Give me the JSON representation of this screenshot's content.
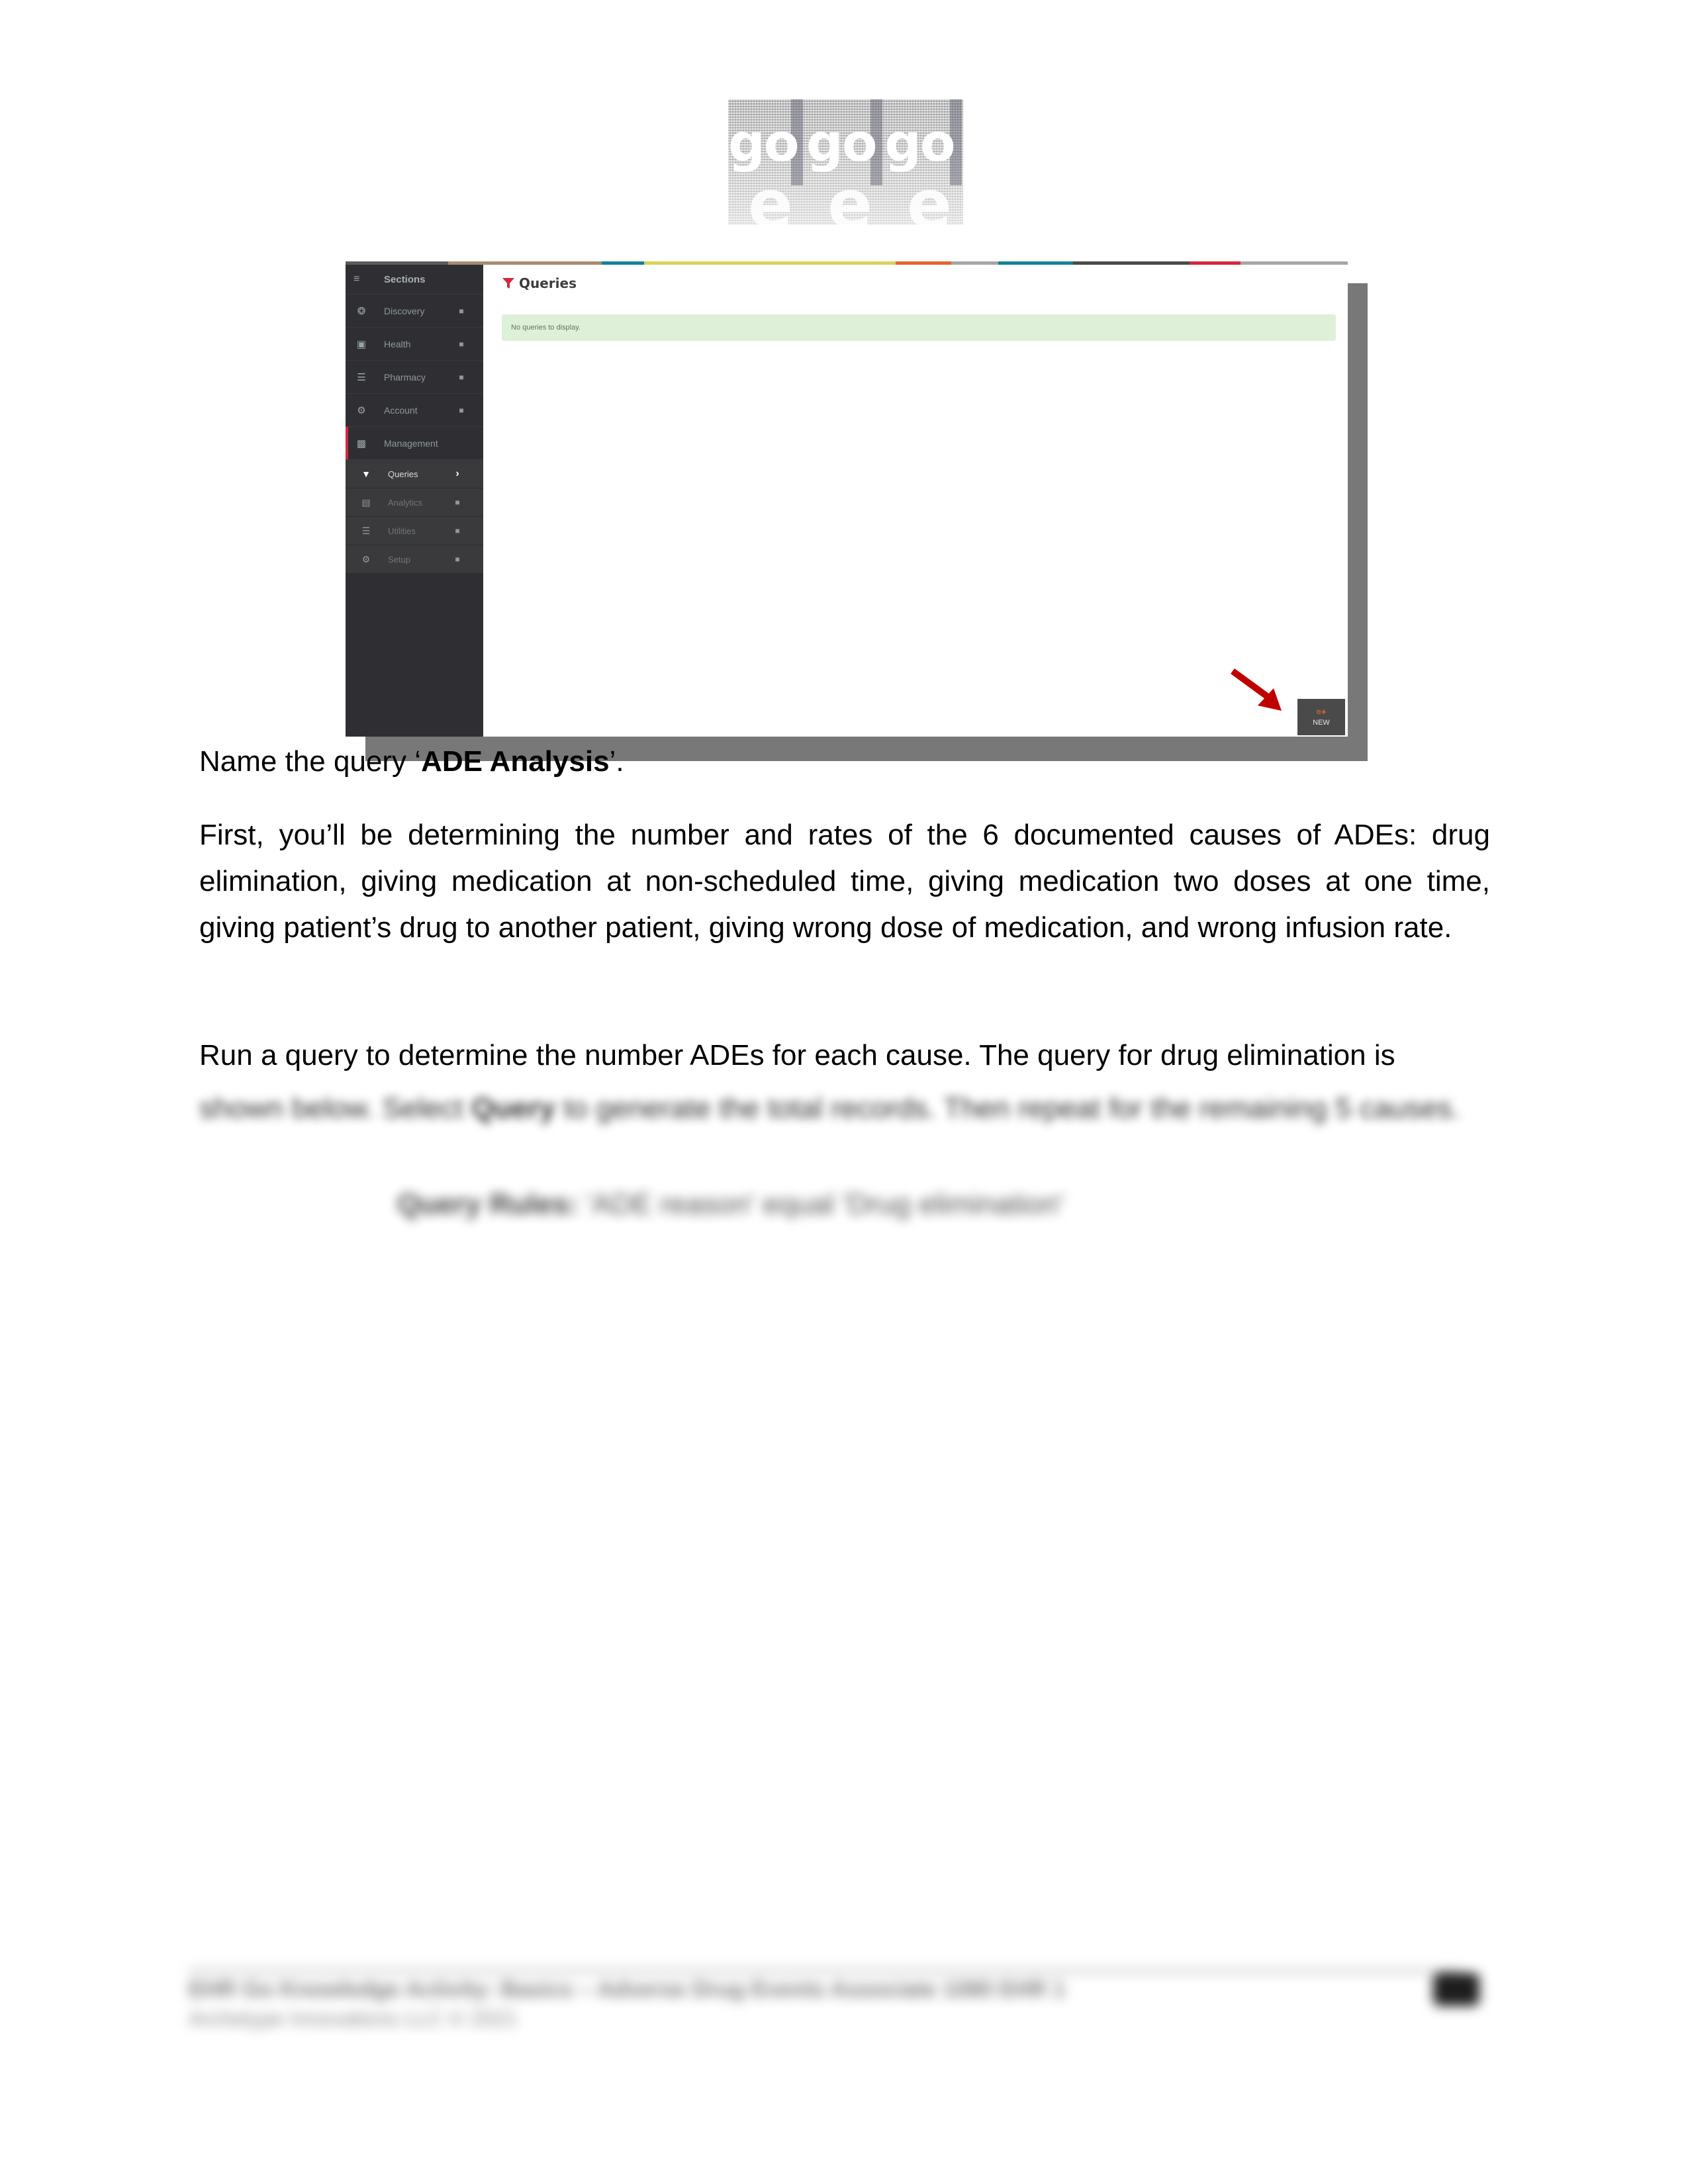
{
  "logo": {
    "alt": "go go go logo",
    "words": [
      "go",
      "go",
      "go"
    ]
  },
  "screenshot": {
    "colorbar": [
      {
        "name": "gray-dark",
        "color": "#5a5a5a",
        "flex": 2.2
      },
      {
        "name": "tan",
        "color": "#a88c6c",
        "flex": 3.3
      },
      {
        "name": "teal",
        "color": "#14829a",
        "flex": 0.9
      },
      {
        "name": "yellow",
        "color": "#d8d35a",
        "flex": 5.4
      },
      {
        "name": "orange",
        "color": "#e3662f",
        "flex": 1.2
      },
      {
        "name": "gray",
        "color": "#a6a6a6",
        "flex": 1.0
      },
      {
        "name": "teal2",
        "color": "#14829a",
        "flex": 1.6
      },
      {
        "name": "charcoal",
        "color": "#4a4a4a",
        "flex": 2.5
      },
      {
        "name": "red",
        "color": "#d6273e",
        "flex": 1.1
      },
      {
        "name": "gray2",
        "color": "#a6a6a6",
        "flex": 2.3
      }
    ],
    "sidebar": {
      "header": {
        "icon": "hamburger-icon",
        "label": "Sections"
      },
      "items": [
        {
          "icon": "gear-icon",
          "label": "Discovery",
          "locked": true
        },
        {
          "icon": "medkit-icon",
          "label": "Health",
          "locked": true
        },
        {
          "icon": "barcode-icon",
          "label": "Pharmacy",
          "locked": true
        },
        {
          "icon": "cogs-icon",
          "label": "Account",
          "locked": true
        },
        {
          "icon": "briefcase-icon",
          "label": "Management",
          "locked": false
        }
      ],
      "subitems": [
        {
          "icon": "funnel-icon",
          "label": "Queries",
          "active": true,
          "trailing": "chevron-right-icon"
        },
        {
          "icon": "chart-icon",
          "label": "Analytics",
          "locked": true
        },
        {
          "icon": "database-icon",
          "label": "Utilities",
          "locked": true
        },
        {
          "icon": "gear-icon",
          "label": "Setup",
          "locked": true
        }
      ]
    },
    "main": {
      "title": "Queries",
      "title_icon": "funnel-icon",
      "alert": "No queries to display.",
      "new_button": {
        "icon": "list-plus-icon",
        "label": "NEW"
      },
      "accent_color": "#d6273e",
      "alert_bg": "#dff0d8"
    }
  },
  "document": {
    "p1": {
      "prefix": "Name the query ‘",
      "bold": "ADE Analysis",
      "suffix": "’."
    },
    "p2": "First, you’ll be determining the number and rates of the 6 documented causes of ADEs: drug elimination, giving medication at non-scheduled time, giving medication two doses at one time, giving patient’s drug to another patient, giving wrong dose of medication, and wrong infusion rate.",
    "p3_line1": "Run a query to determine the number ADEs for each cause. The query for drug elimination is",
    "p3_rest": {
      "prefix": "shown below. Select ",
      "bold": "Query",
      "suffix": " to generate the total records. Then repeat for the remaining 5 causes."
    },
    "query_rule": {
      "label": "Query Rules:",
      "value": "'ADE reason' equal 'Drug elimination'"
    }
  },
  "footer": {
    "line1": "EHR Go Knowledge Activity: Basics – Adverse Drug Events Associate 1080 EHR 1",
    "line2": "Archetype Innovations LLC © 2021",
    "page": "1"
  }
}
